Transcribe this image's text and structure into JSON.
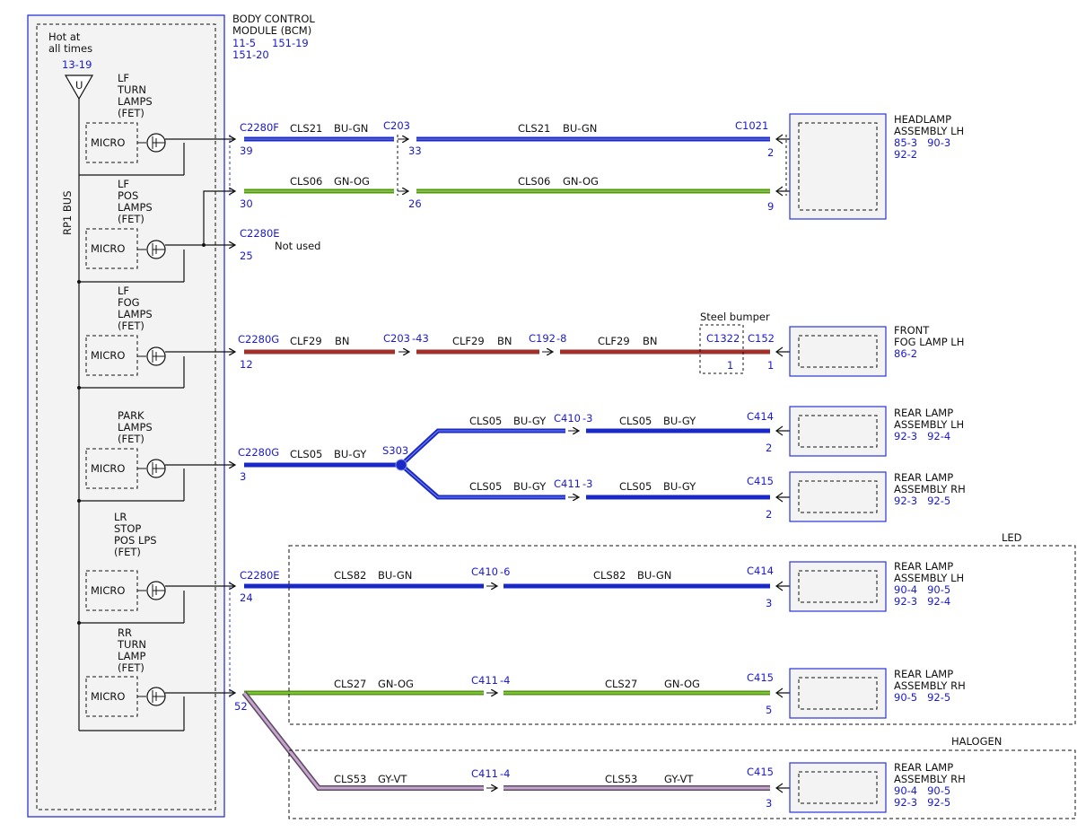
{
  "bcm": {
    "title_line1": "BODY CONTROL",
    "title_line2": "MODULE (BCM)",
    "ref1": "11-5",
    "ref2": "151-19",
    "ref3": "151-20",
    "hot_line1": "Hot at",
    "hot_line2": "all times",
    "hot_ref": "13-19",
    "fuse_symbol": "U",
    "bus_label": "RP1 BUS",
    "micro_label": "MICRO"
  },
  "drivers": [
    {
      "lines": [
        "LF",
        "TURN",
        "LAMPS",
        "(FET)"
      ]
    },
    {
      "lines": [
        "LF",
        "POS",
        "LAMPS",
        "(FET)"
      ]
    },
    {
      "lines": [
        "LF",
        "FOG",
        "LAMPS",
        "(FET)"
      ]
    },
    {
      "lines": [
        "PARK",
        "LAMPS",
        "(FET)"
      ]
    },
    {
      "lines": [
        "LR",
        "STOP",
        "POS LPS",
        "(FET)"
      ]
    },
    {
      "lines": [
        "RR",
        "TURN",
        "LAMP",
        "(FET)"
      ]
    }
  ],
  "circuits": {
    "turn_lf": {
      "conn": "C2280F",
      "pin": "39",
      "seg1_circuit": "CLS21",
      "seg1_color": "BU-GN",
      "inline": "C203",
      "inline_pin": "33",
      "seg2_circuit": "CLS21",
      "seg2_color": "BU-GN",
      "dest_conn": "C1021",
      "dest_pin": "2"
    },
    "pos_lf": {
      "pin": "30",
      "seg1_circuit": "CLS06",
      "seg1_color": "GN-OG",
      "inline_pin": "26",
      "seg2_circuit": "CLS06",
      "seg2_color": "GN-OG",
      "dest_pin": "9"
    },
    "unused": {
      "conn": "C2280E",
      "pin": "25",
      "note": "Not used"
    },
    "fog_lf": {
      "conn": "C2280G",
      "pin": "12",
      "seg1_circuit": "CLF29",
      "seg1_color": "BN",
      "inline1": "C203",
      "inline1_pin": "-43",
      "seg2_circuit": "CLF29",
      "seg2_color": "BN",
      "inline2": "C192",
      "inline2_pin": "-8",
      "seg3_circuit": "CLF29",
      "seg3_color": "BN",
      "bumper_label": "Steel bumper",
      "bumper_conn": "C1322",
      "bumper_pin": "1",
      "dest_conn": "C152",
      "dest_pin": "1"
    },
    "park": {
      "conn": "C2280G",
      "pin": "3",
      "circuit": "CLS05",
      "color": "BU-GY",
      "splice": "S303",
      "upper": {
        "seg1_circuit": "CLS05",
        "seg1_color": "BU-GY",
        "inline": "C410",
        "inline_pin": "-3",
        "seg2_circuit": "CLS05",
        "seg2_color": "BU-GY",
        "dest_conn": "C414",
        "dest_pin": "2"
      },
      "lower": {
        "seg1_circuit": "CLS05",
        "seg1_color": "BU-GY",
        "inline": "C411",
        "inline_pin": "-3",
        "seg2_circuit": "CLS05",
        "seg2_color": "BU-GY",
        "dest_conn": "C415",
        "dest_pin": "2"
      }
    },
    "stop_lr": {
      "conn": "C2280E",
      "pin": "24",
      "seg1_circuit": "CLS82",
      "seg1_color": "BU-GN",
      "inline": "C410",
      "inline_pin": "-6",
      "seg2_circuit": "CLS82",
      "seg2_color": "BU-GN",
      "dest_conn": "C414",
      "dest_pin": "3"
    },
    "turn_rr": {
      "pin": "52",
      "led": {
        "seg1_circuit": "CLS27",
        "seg1_color": "GN-OG",
        "inline": "C411",
        "inline_pin": "-4",
        "seg2_circuit": "CLS27",
        "seg2_color": "GN-OG",
        "dest_conn": "C415",
        "dest_pin": "5"
      },
      "halogen": {
        "seg1_circuit": "CLS53",
        "seg1_color": "GY-VT",
        "inline": "C411",
        "inline_pin": "-4",
        "seg2_circuit": "CLS53",
        "seg2_color": "GY-VT",
        "dest_conn": "C415",
        "dest_pin": "3"
      }
    }
  },
  "variants": {
    "led": "LED",
    "halogen": "HALOGEN"
  },
  "components": [
    {
      "lines": [
        "HEADLAMP",
        "ASSEMBLY LH"
      ],
      "refs": [
        "85-3   90-3",
        "92-2"
      ]
    },
    {
      "lines": [
        "FRONT",
        "FOG LAMP LH"
      ],
      "refs": [
        "86-2"
      ]
    },
    {
      "lines": [
        "REAR LAMP",
        "ASSEMBLY LH"
      ],
      "refs": [
        "92-3   92-4"
      ]
    },
    {
      "lines": [
        "REAR LAMP",
        "ASSEMBLY RH"
      ],
      "refs": [
        "92-3   92-5"
      ]
    },
    {
      "lines": [
        "REAR LAMP",
        "ASSEMBLY LH"
      ],
      "refs": [
        "90-4   90-5",
        "92-3   92-4"
      ]
    },
    {
      "lines": [
        "REAR LAMP",
        "ASSEMBLY RH"
      ],
      "refs": [
        "90-5   92-5"
      ]
    },
    {
      "lines": [
        "REAR LAMP",
        "ASSEMBLY RH"
      ],
      "refs": [
        "90-4   90-5",
        "92-3   92-5"
      ]
    }
  ],
  "colors": {
    "blue_wire": "#1a28c8",
    "green_wire": "#4e9a06",
    "brown_wire": "#a0302a",
    "gray_violet_wire": "#a07aa6",
    "module_outline": "#2b33d6",
    "label_blue": "#1a1ad0"
  }
}
